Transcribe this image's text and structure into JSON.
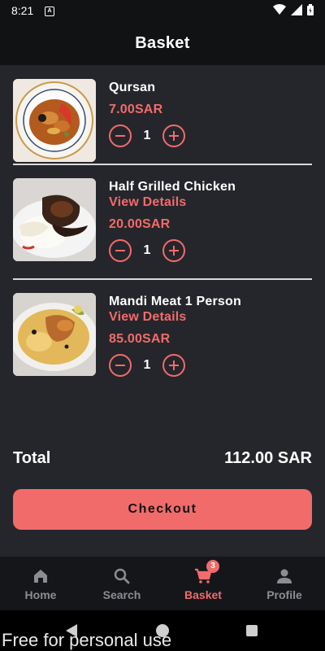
{
  "status_bar": {
    "time": "8:21",
    "a_label": "A"
  },
  "header": {
    "title": "Basket"
  },
  "items": [
    {
      "name": "Qursan",
      "details": "",
      "price": "7.00SAR",
      "qty": "1",
      "image": "qursan-stew-image"
    },
    {
      "name": "Half Grilled Chicken",
      "details": "View Details",
      "price": "20.00SAR",
      "qty": "1",
      "image": "grilled-chicken-image"
    },
    {
      "name": "Mandi Meat 1 Person",
      "details": "View Details",
      "price": "85.00SAR",
      "qty": "1",
      "image": "mandi-meat-image"
    }
  ],
  "total": {
    "label": "Total",
    "value": "112.00 SAR"
  },
  "checkout": {
    "label": "Checkout"
  },
  "nav": {
    "items": [
      {
        "label": "Home",
        "icon": "home-icon"
      },
      {
        "label": "Search",
        "icon": "search-icon"
      },
      {
        "label": "Basket",
        "icon": "cart-icon"
      },
      {
        "label": "Profile",
        "icon": "person-icon"
      }
    ],
    "basket_badge": "3"
  },
  "watermark": "Free for personal use",
  "colors": {
    "accent": "#f26b6b",
    "background": "#25262b",
    "header": "#111214"
  }
}
